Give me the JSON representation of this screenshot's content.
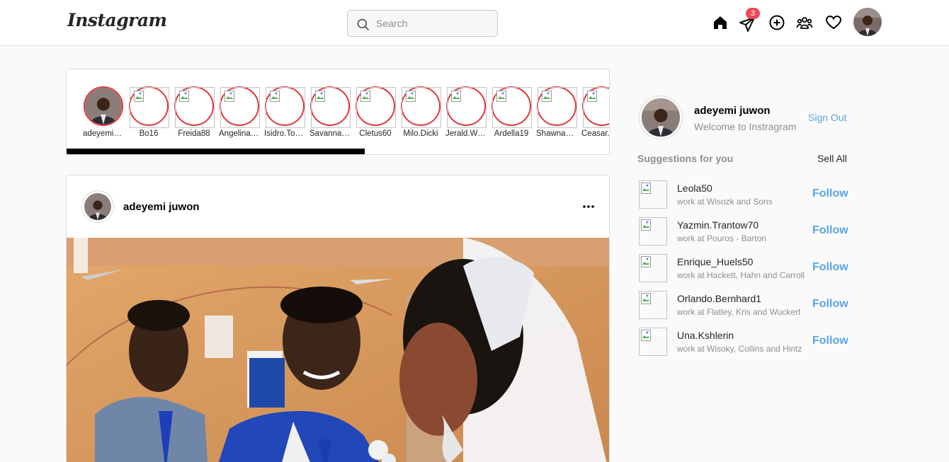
{
  "header": {
    "logo_text": "Instagram",
    "search_placeholder": "Search",
    "messages_badge": "3"
  },
  "stories": {
    "items": [
      {
        "name": "adeyemi juwon",
        "has_photo": true
      },
      {
        "name": "Bo16",
        "has_photo": false
      },
      {
        "name": "Freida88",
        "has_photo": false
      },
      {
        "name": "Angelina_Hauck",
        "has_photo": false
      },
      {
        "name": "Isidro.Towne",
        "has_photo": false
      },
      {
        "name": "Savannah.Jakubowski",
        "has_photo": false
      },
      {
        "name": "Cletus60",
        "has_photo": false
      },
      {
        "name": "Milo.Dicki",
        "has_photo": false
      },
      {
        "name": "Jerald.Weber",
        "has_photo": false
      },
      {
        "name": "Ardella19",
        "has_photo": false
      },
      {
        "name": "Shawna_Kihn",
        "has_photo": false
      },
      {
        "name": "Ceasar.Kuhn",
        "has_photo": false
      }
    ],
    "scroll_progress": 0.55
  },
  "post": {
    "username": "adeyemi juwon",
    "more_icon": "more-horizontal-icon"
  },
  "sidebar": {
    "username": "adeyemi juwon",
    "subtitle": "Welcome to Instragram",
    "signout_label": "Sign Out",
    "suggestions_title": "Suggestions for you",
    "see_all_label": "Sell All",
    "suggestions": [
      {
        "name": "Leola50",
        "work": "work at Wisozk and Sons",
        "action": "Follow"
      },
      {
        "name": "Yazmin.Trantow70",
        "work": "work at Pouros - Barton",
        "action": "Follow"
      },
      {
        "name": "Enrique_Huels50",
        "work": "work at Hackett, Hahn and Carroll",
        "action": "Follow"
      },
      {
        "name": "Orlando.Bernhard1",
        "work": "work at Flatley, Kris and Wuckert",
        "action": "Follow"
      },
      {
        "name": "Una.Kshlerin",
        "work": "work at Wisoky, Collins and Hintz",
        "action": "Follow"
      }
    ]
  },
  "colors": {
    "story_ring": "#e0373c",
    "link_blue": "#5aa4e8",
    "badge_red": "#ed4956"
  }
}
